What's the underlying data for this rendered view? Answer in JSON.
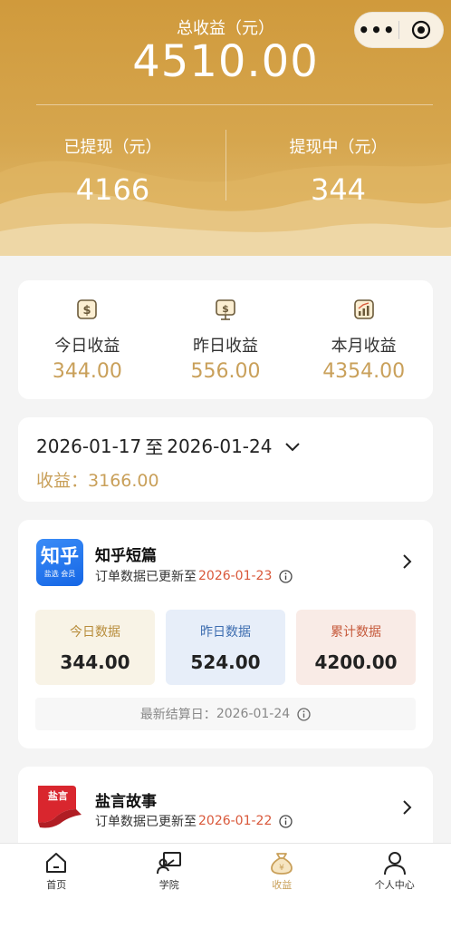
{
  "header": {
    "total_label": "总收益（元）",
    "total_value": "4510.00",
    "withdrawn_label": "已提现（元）",
    "withdrawn_value": "4166",
    "pending_label": "提现中（元）",
    "pending_value": "344"
  },
  "stats": [
    {
      "icon": "dollar-icon",
      "label": "今日收益",
      "value": "344.00"
    },
    {
      "icon": "monitor-dollar-icon",
      "label": "昨日收益",
      "value": "556.00"
    },
    {
      "icon": "chart-up-icon",
      "label": "本月收益",
      "value": "4354.00"
    }
  ],
  "range": {
    "start": "2026-01-17",
    "sep": "至",
    "end": "2026-01-24",
    "income_label": "收益：",
    "income_value": "3166.00"
  },
  "platforms": [
    {
      "name": "知乎短篇",
      "logo_text": "知乎",
      "logo_sub": "盐选 会员",
      "update_prefix": "订单数据已更新至",
      "update_date": "2026-01-23",
      "today_label": "今日数据",
      "today_value": "344.00",
      "yesterday_label": "昨日数据",
      "yesterday_value": "524.00",
      "total_label": "累计数据",
      "total_value": "4200.00",
      "settle_prefix": "最新结算日：",
      "settle_date": "2026-01-24"
    },
    {
      "name": "盐言故事",
      "logo_text": "盐言",
      "update_prefix": "订单数据已更新至",
      "update_date": "2026-01-22"
    }
  ],
  "tabs": [
    {
      "label": "首页",
      "icon": "home-icon"
    },
    {
      "label": "学院",
      "icon": "academy-icon"
    },
    {
      "label": "收益",
      "icon": "money-bag-icon"
    },
    {
      "label": "个人中心",
      "icon": "person-icon"
    }
  ],
  "colors": {
    "gold": "#c9a05a",
    "header": "#d09a3c",
    "accent_red": "#d9583a"
  }
}
